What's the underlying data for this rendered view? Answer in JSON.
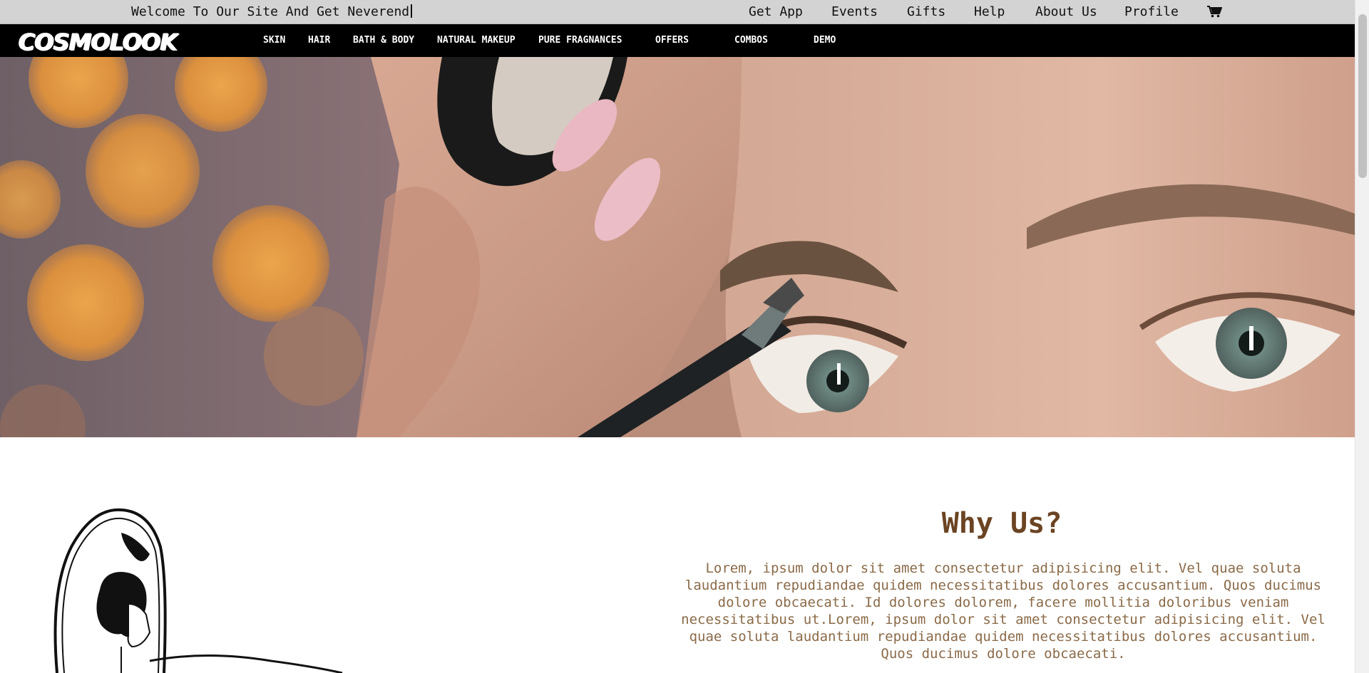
{
  "topbar": {
    "welcome": "Welcome To Our Site And Get Neverend",
    "links": [
      "Get App",
      "Events",
      "Gifts",
      "Help",
      "About Us",
      "Profile"
    ],
    "cart_icon": "cart-icon"
  },
  "nav": {
    "logo": "COSMOLOOK",
    "items": [
      "SKIN",
      "HAIR",
      "BATH & BODY",
      "NATURAL MAKEUP",
      "PURE FRAGNANCES",
      "OFFERS",
      "COMBOS",
      "DEMO"
    ]
  },
  "why": {
    "title": "Why Us?",
    "text": "Lorem, ipsum dolor sit amet consectetur adipisicing elit. Vel quae soluta laudantium repudiandae quidem necessitatibus dolores accusantium. Quos ducimus dolore obcaecati. Id dolores dolorem, facere mollitia doloribus veniam necessitatibus ut.Lorem, ipsum dolor sit amet consectetur adipisicing elit. Vel quae soluta laudantium repudiandae quidem necessitatibus dolores accusantium. Quos ducimus dolore obcaecati."
  },
  "colors": {
    "topbar_bg": "#d3d3d3",
    "nav_bg": "#000000",
    "heading": "#6b4423",
    "body_text": "#8a6a48"
  }
}
